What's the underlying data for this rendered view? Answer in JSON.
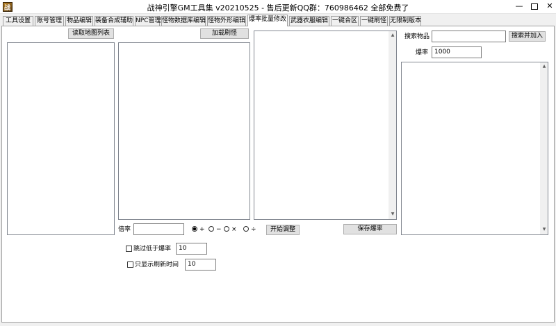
{
  "window": {
    "title": "战神引擎GM工具集 v20210525 - 售后更新QQ群：760986462  全部免费了",
    "icon_glyph": "战",
    "min_glyph": "—",
    "close_glyph": "✕"
  },
  "tabs": [
    "工具设置",
    "账号管理",
    "物品编辑",
    "装备合成辅助",
    "NPC管理",
    "怪物数据库编辑",
    "怪物外形编辑",
    "爆率批量修改",
    "武器衣服编辑",
    "一键合区",
    "一键刷怪",
    "无限制版本"
  ],
  "active_tab": "爆率批量修改",
  "left": {
    "read_map_button": "读取地图列表",
    "load_monster_button": "加载刷怪"
  },
  "rate": {
    "label": "倍率",
    "value": "",
    "ops": [
      "+",
      "−",
      "×",
      "÷"
    ],
    "selected": "+"
  },
  "skip_low": {
    "label": "跳过低于爆率",
    "checked": false,
    "value": "10"
  },
  "only_refresh": {
    "label": "只显示刷新时间",
    "checked": false,
    "value": "10"
  },
  "middle": {
    "start_button": "开始调整",
    "save_button": "保存爆率",
    "scroll_up": "▲",
    "scroll_down": "▼"
  },
  "right": {
    "search_label": "搜索物品",
    "search_value": "",
    "search_add_button": "搜索并加入",
    "drop_rate_label": "爆率",
    "drop_rate_value": "1000",
    "scroll_up": "▲",
    "scroll_down": "▼"
  }
}
